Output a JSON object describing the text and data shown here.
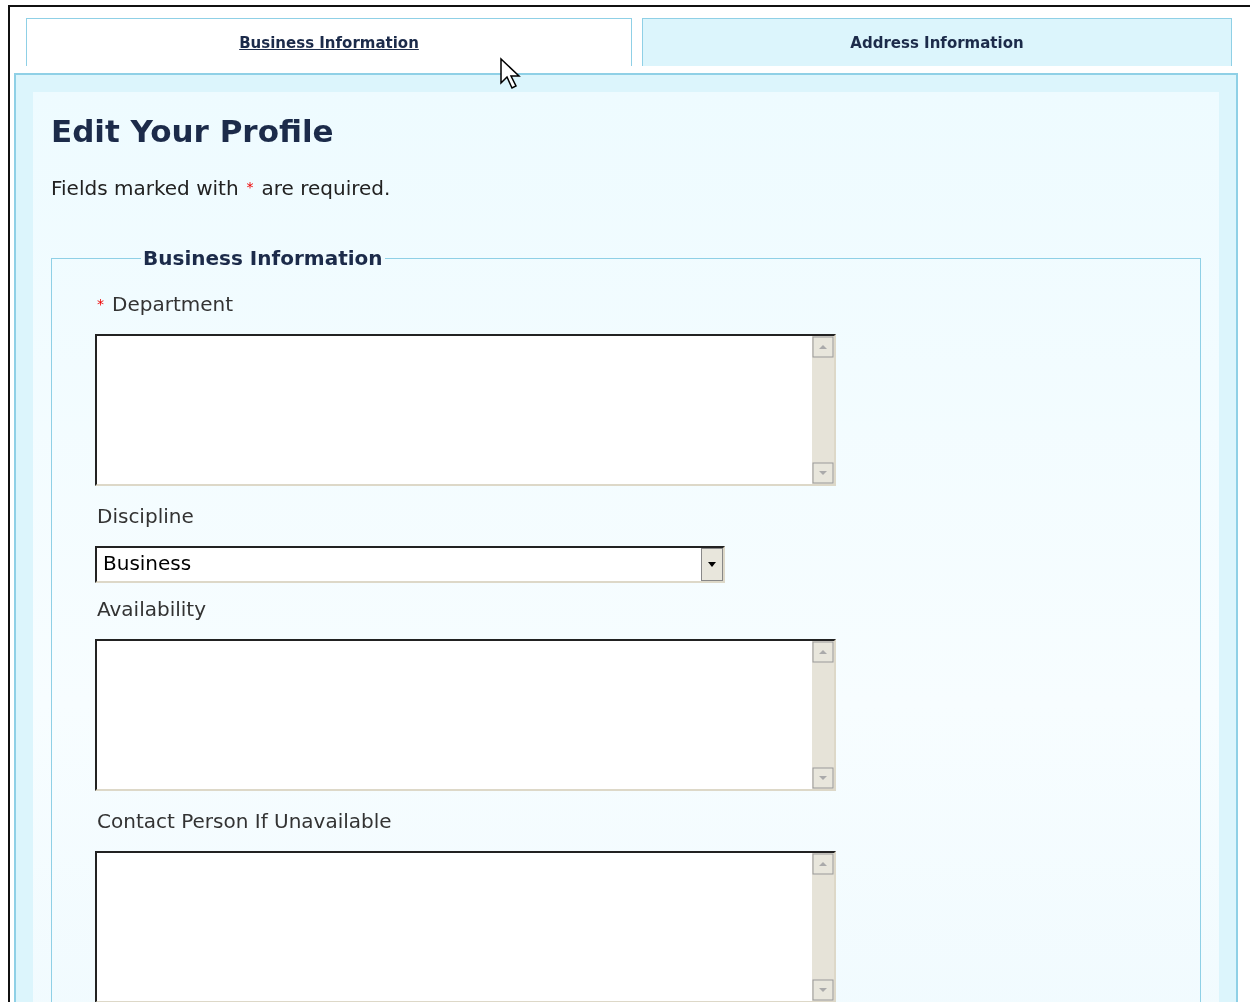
{
  "tabs": [
    {
      "label": "Business Information",
      "selected": true
    },
    {
      "label": "Address Information",
      "selected": false
    }
  ],
  "heading": "Edit Your Profile",
  "required_note": {
    "before": "Fields marked with",
    "mark": "*",
    "after": "are required."
  },
  "section": {
    "legend": "Business Information",
    "fields": [
      {
        "kind": "textarea",
        "label": "Department",
        "required": true,
        "required_mark": "*"
      },
      {
        "kind": "select",
        "label": "Discipline",
        "required": false,
        "value": "Business"
      },
      {
        "kind": "textarea",
        "label": "Availability",
        "required": false
      },
      {
        "kind": "textarea",
        "label": "Contact Person If Unavailable",
        "required": false
      }
    ]
  }
}
